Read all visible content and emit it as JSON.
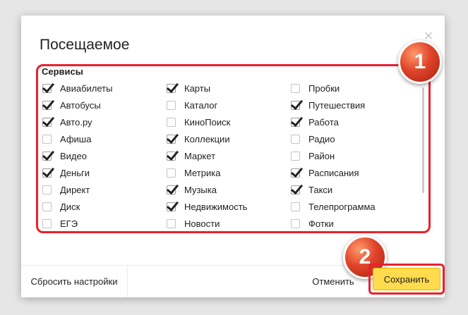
{
  "dialog": {
    "title": "Посещаемое",
    "section_title": "Сервисы"
  },
  "columns": [
    [
      {
        "label": "Авиабилеты",
        "checked": true
      },
      {
        "label": "Автобусы",
        "checked": true
      },
      {
        "label": "Авто.ру",
        "checked": true
      },
      {
        "label": "Афиша",
        "checked": false
      },
      {
        "label": "Видео",
        "checked": true
      },
      {
        "label": "Деньги",
        "checked": true
      },
      {
        "label": "Директ",
        "checked": false
      },
      {
        "label": "Диск",
        "checked": false
      },
      {
        "label": "ЕГЭ",
        "checked": false
      }
    ],
    [
      {
        "label": "Карты",
        "checked": true
      },
      {
        "label": "Каталог",
        "checked": false
      },
      {
        "label": "КиноПоиск",
        "checked": false
      },
      {
        "label": "Коллекции",
        "checked": true
      },
      {
        "label": "Маркет",
        "checked": true
      },
      {
        "label": "Метрика",
        "checked": false
      },
      {
        "label": "Музыка",
        "checked": true
      },
      {
        "label": "Недвижимость",
        "checked": true
      },
      {
        "label": "Новости",
        "checked": false
      }
    ],
    [
      {
        "label": "Пробки",
        "checked": false
      },
      {
        "label": "Путешествия",
        "checked": true
      },
      {
        "label": "Работа",
        "checked": true
      },
      {
        "label": "Радио",
        "checked": false
      },
      {
        "label": "Район",
        "checked": false
      },
      {
        "label": "Расписания",
        "checked": true
      },
      {
        "label": "Такси",
        "checked": true
      },
      {
        "label": "Телепрограмма",
        "checked": false
      },
      {
        "label": "Фотки",
        "checked": false
      }
    ]
  ],
  "footer": {
    "reset_label": "Сбросить настройки",
    "cancel_label": "Отменить",
    "save_label": "Сохранить"
  },
  "annotations": {
    "badge1": "1",
    "badge2": "2"
  },
  "colors": {
    "highlight": "#e8212e",
    "save_button": "#ffdb4d"
  }
}
